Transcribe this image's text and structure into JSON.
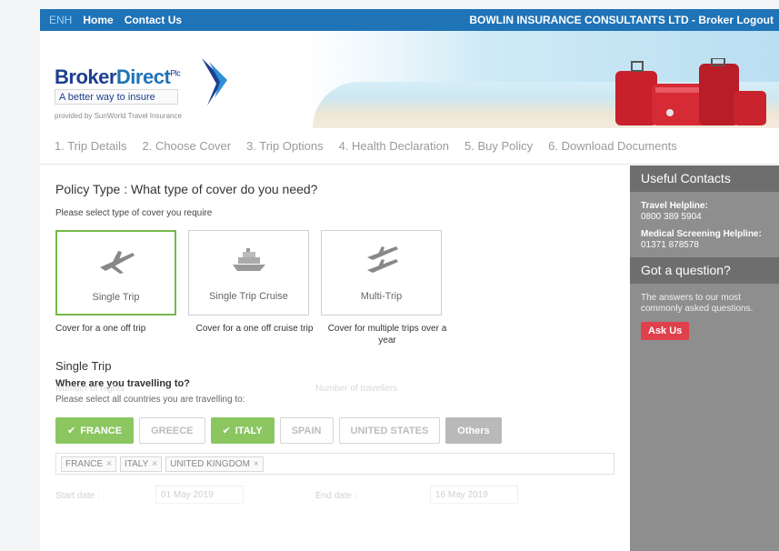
{
  "topbar": {
    "lang": "ENH",
    "home": "Home",
    "contact": "Contact Us",
    "company": "BOWLIN INSURANCE CONSULTANTS LTD -",
    "logout": "Broker Logout"
  },
  "logo": {
    "brand_a": "Broker",
    "brand_b": "Direct",
    "suffix": "Plc",
    "tagline": "A better way to insure",
    "provided_by": "provided by SunWorld Travel Insurance"
  },
  "steps": [
    "1. Trip Details",
    "2. Choose Cover",
    "3. Trip Options",
    "4. Health Declaration",
    "5. Buy Policy",
    "6. Download Documents"
  ],
  "policy": {
    "title": "Policy Type : What type of cover do you need?",
    "subtitle": "Please select type of cover you require",
    "cards": [
      {
        "label": "Single Trip",
        "caption": "Cover for a one off trip",
        "icon": "plane-icon",
        "selected": true
      },
      {
        "label": "Single Trip Cruise",
        "caption": "Cover for a one off cruise trip",
        "icon": "ship-icon",
        "selected": false
      },
      {
        "label": "Multi-Trip",
        "caption": "Cover for multiple trips over a year",
        "icon": "multi-plane-icon",
        "selected": false
      }
    ]
  },
  "travel": {
    "section_title": "Single Trip",
    "question": "Where are you travelling to?",
    "hint": "Please select all countries you are travelling to:",
    "chips": [
      {
        "label": "FRANCE",
        "selected": true
      },
      {
        "label": "GREECE",
        "selected": false
      },
      {
        "label": "ITALY",
        "selected": true
      },
      {
        "label": "SPAIN",
        "selected": false
      },
      {
        "label": "UNITED STATES",
        "selected": false
      },
      {
        "label": "Others",
        "selected": false
      }
    ],
    "tags": [
      "FRANCE",
      "ITALY",
      "UNITED KINGDOM"
    ],
    "start_label": "Start date :",
    "start_value": "01 May 2019",
    "end_label": "End date :",
    "end_value": "16 May 2019",
    "nights_label": "Number of nights",
    "travellers_label": "Number of travellers"
  },
  "sidebar": {
    "contacts_title": "Useful Contacts",
    "travel_helpline_label": "Travel Helpline:",
    "travel_helpline_number": "0800 389 5904",
    "medical_label": "Medical Screening Helpline:",
    "medical_number": "01371 878578",
    "question_title": "Got a question?",
    "question_desc": "The answers to our most commonly asked questions.",
    "ask_button": "Ask Us"
  },
  "colors": {
    "topbar": "#1f73b7",
    "selected_green": "#8cc661",
    "sidebar_grey": "#8e8e8e",
    "ask_red": "#e0404b"
  }
}
